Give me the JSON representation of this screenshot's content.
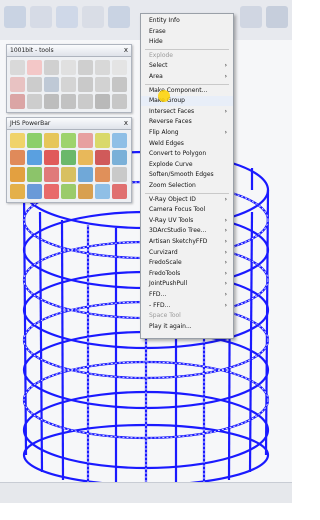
{
  "panels": {
    "tools_title": "1001bit - tools",
    "powerbar_title": "JHS PowerBar",
    "close_glyph": "x"
  },
  "context_menu": {
    "items": [
      {
        "label": "Entity Info"
      },
      {
        "label": "Erase"
      },
      {
        "label": "Hide"
      },
      {
        "label": "Explode",
        "disabled": true
      },
      {
        "label": "Select",
        "submenu": true
      },
      {
        "label": "Area",
        "submenu": true
      },
      {
        "label": "Make Component..."
      },
      {
        "label": "Make Group",
        "hovered": true
      },
      {
        "label": "Intersect Faces",
        "submenu": true
      },
      {
        "label": "Reverse Faces"
      },
      {
        "label": "Flip Along",
        "submenu": true
      },
      {
        "label": "Weld Edges"
      },
      {
        "label": "Convert to Polygon"
      },
      {
        "label": "Explode Curve"
      },
      {
        "label": "Soften/Smooth Edges"
      },
      {
        "label": "Zoom Selection"
      },
      {
        "label": "V-Ray Object ID",
        "submenu": true
      },
      {
        "label": "Camera Focus Tool"
      },
      {
        "label": "V-Ray UV Tools",
        "submenu": true
      },
      {
        "label": "3DArcStudio Tree...",
        "submenu": true
      },
      {
        "label": "Artisan SketchyFFD",
        "submenu": true
      },
      {
        "label": "Curvizard",
        "submenu": true
      },
      {
        "label": "FredoScale",
        "submenu": true
      },
      {
        "label": "FredoTools",
        "submenu": true
      },
      {
        "label": "JointPushPull",
        "submenu": true
      },
      {
        "label": "FFD...",
        "submenu": true
      },
      {
        "label": "- FFD...",
        "submenu": true
      },
      {
        "label": "Space Tool",
        "disabled": true
      },
      {
        "label": "Play it again..."
      }
    ],
    "arrow_glyph": "›"
  },
  "colors": {
    "wireframe": "#1a1aff",
    "menu_bg": "#f1f1f1",
    "hover_highlight": "#ffd200"
  }
}
